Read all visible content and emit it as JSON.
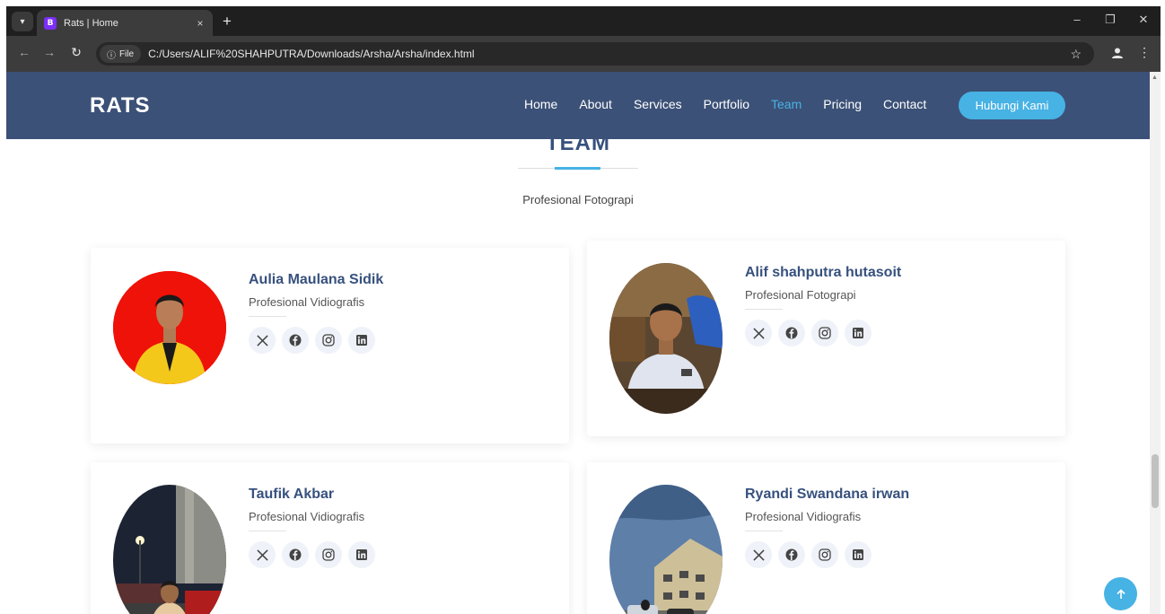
{
  "browser": {
    "tab_title": "Rats | Home",
    "tab_close": "×",
    "new_tab": "+",
    "site_info_label": "File",
    "url": "C:/Users/ALIF%20SHAHPUTRA/Downloads/Arsha/Arsha/index.html",
    "minimize": "–",
    "restore": "❐",
    "close": "✕"
  },
  "site": {
    "logo": "RATS",
    "nav": [
      {
        "label": "Home",
        "active": false
      },
      {
        "label": "About",
        "active": false
      },
      {
        "label": "Services",
        "active": false
      },
      {
        "label": "Portfolio",
        "active": false
      },
      {
        "label": "Team",
        "active": true
      },
      {
        "label": "Pricing",
        "active": false
      },
      {
        "label": "Contact",
        "active": false
      }
    ],
    "cta": "Hubungi Kami"
  },
  "section": {
    "title": "TEAM",
    "subtitle": "Profesional Fotograpi"
  },
  "team": [
    {
      "name": "Aulia Maulana Sidik",
      "role": "Profesional Vidiografis"
    },
    {
      "name": "Alif shahputra hutasoit",
      "role": "Profesional Fotograpi"
    },
    {
      "name": "Taufik Akbar",
      "role": "Profesional Vidiografis"
    },
    {
      "name": "Ryandi Swandana irwan",
      "role": "Profesional Vidiografis"
    }
  ],
  "social_icons": [
    "x-twitter-icon",
    "facebook-icon",
    "instagram-icon",
    "linkedin-icon"
  ],
  "colors": {
    "header_bg": "#3c5177",
    "accent": "#47b2e4",
    "heading": "#37517e"
  }
}
